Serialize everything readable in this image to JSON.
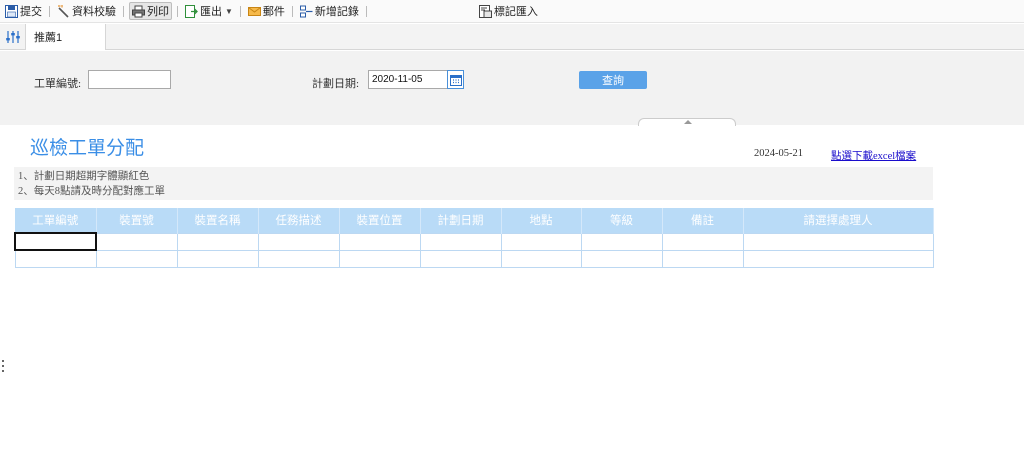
{
  "toolbar": {
    "items": [
      {
        "label": "提交",
        "icon": "save-icon"
      },
      {
        "label": "資料校驗",
        "icon": "wand-icon"
      },
      {
        "label": "列印",
        "icon": "printer-icon",
        "active": true
      },
      {
        "label": "匯出",
        "icon": "export-icon",
        "dropdown": true
      },
      {
        "label": "郵件",
        "icon": "mail-icon"
      },
      {
        "label": "新增記錄",
        "icon": "insert-row-icon"
      },
      {
        "label": "標記匯入",
        "icon": "import-icon"
      }
    ]
  },
  "tabs": {
    "settings_icon": "sliders-icon",
    "items": [
      {
        "label": "推薦1"
      }
    ]
  },
  "params": {
    "order_no_label": "工單編號:",
    "order_no_value": "",
    "plan_date_label": "計劃日期:",
    "plan_date_value": "2020-11-05",
    "query_label": "查詢"
  },
  "report": {
    "title": "巡檢工單分配",
    "date": "2024-05-21",
    "download_link": "點選下載excel檔案",
    "notes": [
      "1、計劃日期超期字體顯紅色",
      "2、每天8點請及時分配對應工單"
    ],
    "columns": [
      "工單編號",
      "裝置號",
      "裝置名稱",
      "任務描述",
      "裝置位置",
      "計劃日期",
      "地點",
      "等級",
      "備註",
      "請選擇處理人"
    ],
    "rows": [
      [
        "",
        "",
        "",
        "",
        "",
        "",
        "",
        "",
        "",
        ""
      ],
      [
        "",
        "",
        "",
        "",
        "",
        "",
        "",
        "",
        "",
        ""
      ]
    ]
  },
  "colors": {
    "accent": "#3a8ee6",
    "header_bg": "#b9dbf7",
    "query_button": "#5aa2e8"
  }
}
